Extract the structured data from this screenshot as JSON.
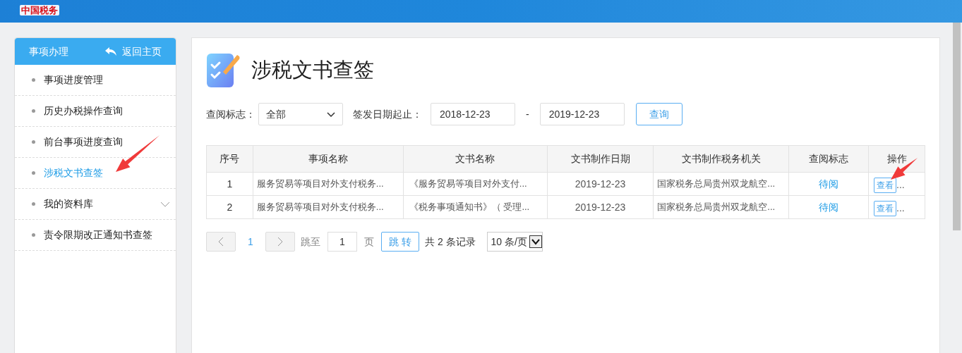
{
  "header": {
    "logo_text": "中国税务"
  },
  "sidebar": {
    "title": "事项办理",
    "back_link": "返回主页",
    "items": [
      {
        "label": "事项进度管理",
        "selected": false,
        "expandable": false
      },
      {
        "label": "历史办税操作查询",
        "selected": false,
        "expandable": false
      },
      {
        "label": "前台事项进度查询",
        "selected": false,
        "expandable": false
      },
      {
        "label": "涉税文书查签",
        "selected": true,
        "expandable": false
      },
      {
        "label": "我的资料库",
        "selected": false,
        "expandable": true
      },
      {
        "label": "责令限期改正通知书查签",
        "selected": false,
        "expandable": false
      }
    ]
  },
  "page": {
    "title": "涉税文书查签"
  },
  "filters": {
    "status_label": "查阅标志：",
    "status_value": "全部",
    "date_label": "签发日期起止：",
    "date_from": "2018-12-23",
    "date_separator": "-",
    "date_to": "2019-12-23",
    "search_button": "查询"
  },
  "table": {
    "columns": [
      "序号",
      "事项名称",
      "文书名称",
      "文书制作日期",
      "文书制作税务机关",
      "查阅标志",
      "操作"
    ],
    "rows": [
      {
        "index": "1",
        "matter": "服务贸易等项目对外支付税务...",
        "document": "《服务贸易等项目对外支付...",
        "date": "2019-12-23",
        "authority": "国家税务总局贵州双龙航空...",
        "status": "待阅",
        "action": "查看",
        "more": "..."
      },
      {
        "index": "2",
        "matter": "服务贸易等项目对外支付税务...",
        "document": "《税务事项通知书》（ 受理...",
        "date": "2019-12-23",
        "authority": "国家税务总局贵州双龙航空...",
        "status": "待阅",
        "action": "查看",
        "more": "..."
      }
    ]
  },
  "pagination": {
    "current_page": "1",
    "jump_label": "跳至",
    "jump_value": "1",
    "page_unit": "页",
    "jump_button": "跳 转",
    "total": "共 2 条记录",
    "page_size": "10 条/页"
  },
  "annotations": [
    {
      "kind": "arrow"
    },
    {
      "kind": "arrow"
    }
  ]
}
